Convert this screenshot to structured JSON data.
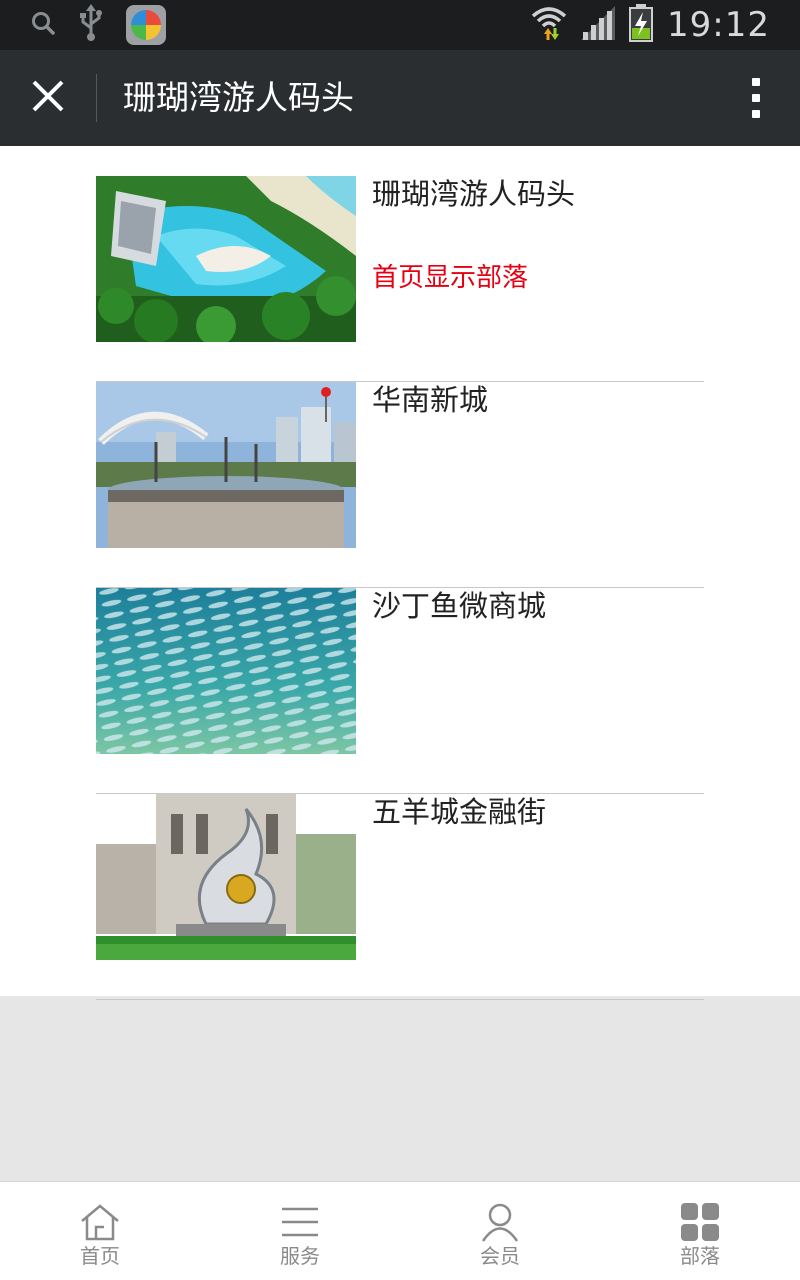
{
  "status_bar": {
    "time": "19:12",
    "icons": [
      "search-icon",
      "usb-icon",
      "app-icon",
      "wifi-icon",
      "signal-icon",
      "battery-charging-icon"
    ]
  },
  "header": {
    "title": "珊瑚湾游人码头",
    "close_icon": "close-icon",
    "more_icon": "more-vertical-icon"
  },
  "list": {
    "items": [
      {
        "title": "珊瑚湾游人码头",
        "subtitle": "首页显示部落",
        "image": "resort-pool-aerial"
      },
      {
        "title": "华南新城",
        "subtitle": "",
        "image": "city-fountain-plaza"
      },
      {
        "title": "沙丁鱼微商城",
        "subtitle": "",
        "image": "sardine-school-underwater"
      },
      {
        "title": "五羊城金融街",
        "subtitle": "",
        "image": "finance-street-sculpture"
      }
    ]
  },
  "bottom_nav": {
    "items": [
      {
        "label": "首页",
        "icon": "home-icon"
      },
      {
        "label": "服务",
        "icon": "list-icon"
      },
      {
        "label": "会员",
        "icon": "user-icon"
      },
      {
        "label": "部落",
        "icon": "grid-icon"
      }
    ]
  },
  "colors": {
    "status_bar": "#1b1d1f",
    "title_bar": "#2b2e31",
    "highlight_red": "#e60012",
    "page_background": "#e6e6e6"
  }
}
